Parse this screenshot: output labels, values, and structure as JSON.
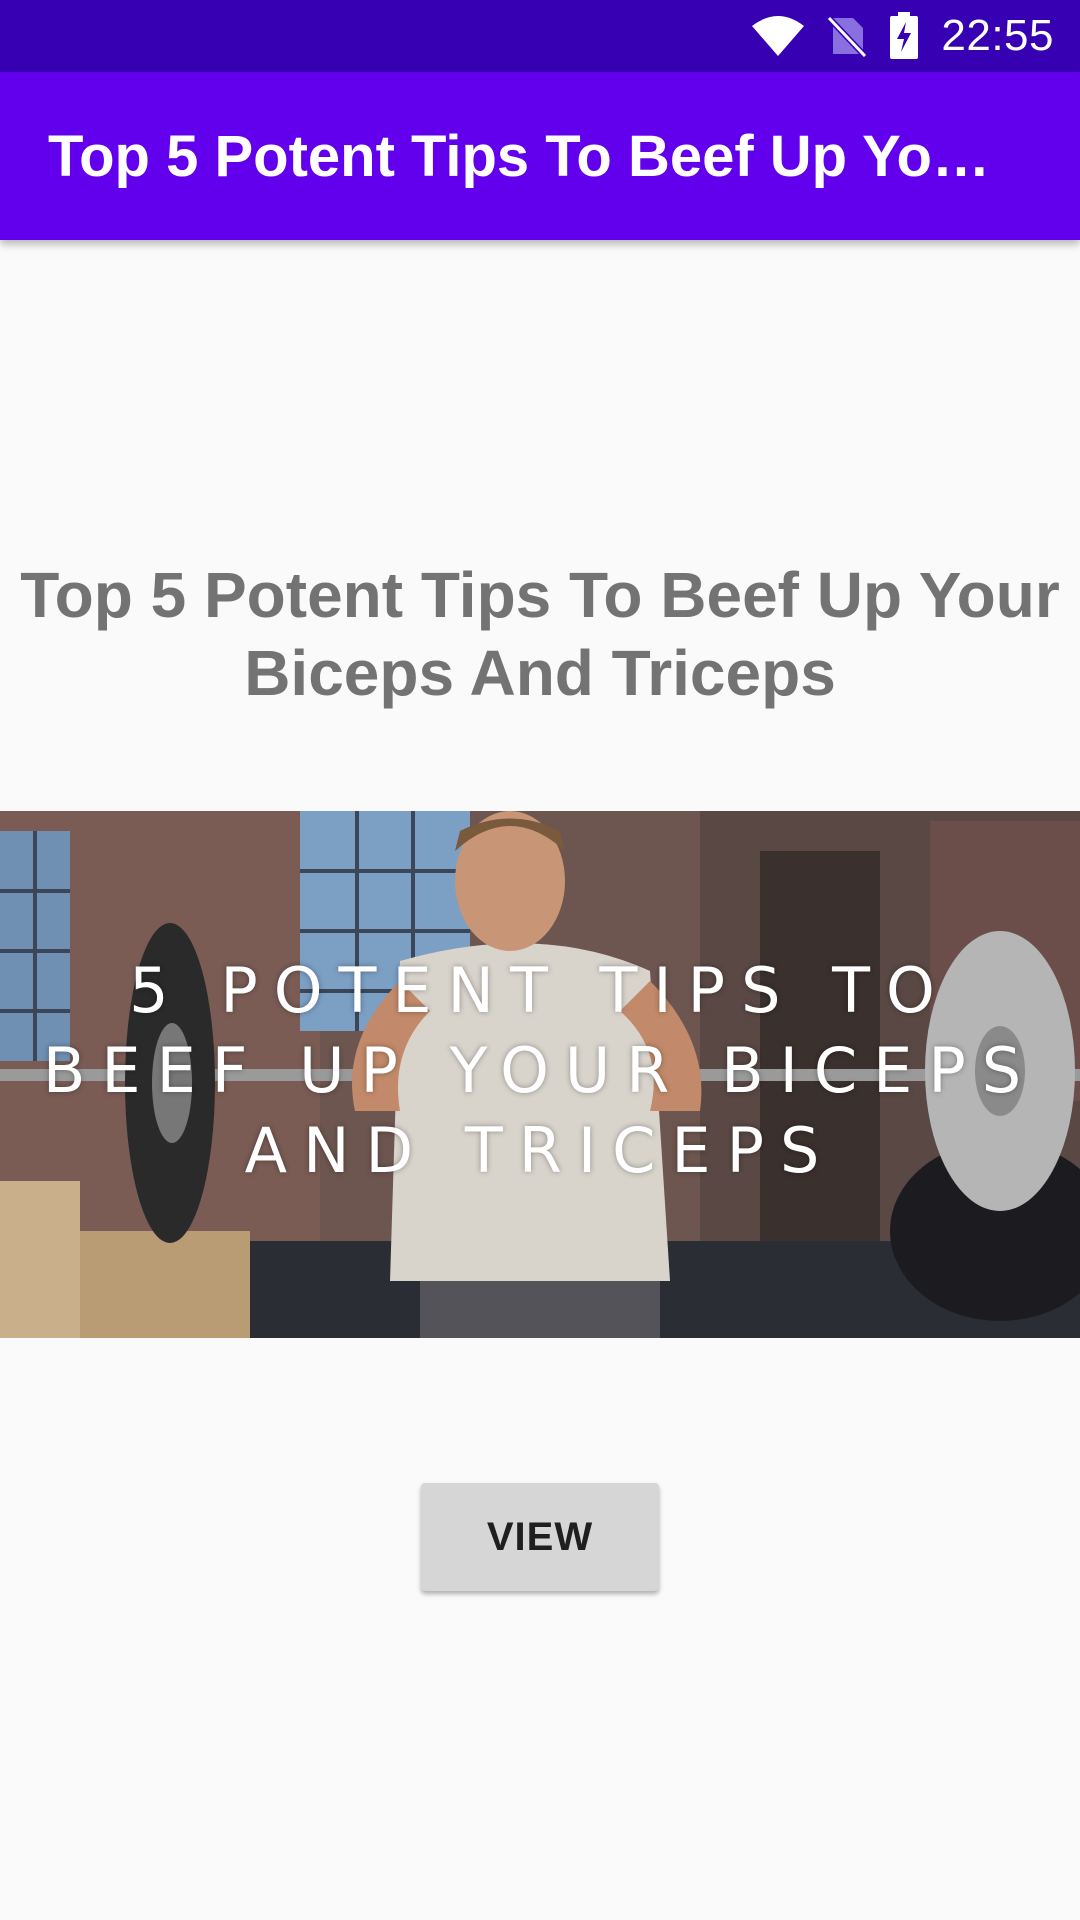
{
  "status_bar": {
    "time": "22:55",
    "icons": [
      "wifi-icon",
      "no-sim-icon",
      "battery-charging-icon"
    ],
    "background_color": "#3700b3"
  },
  "app_bar": {
    "title": "Top 5 Potent Tips To Beef Up Your…",
    "background_color": "#6200ee"
  },
  "content": {
    "title": "Top 5 Potent Tips To Beef Up Your Biceps And Triceps",
    "hero_image": {
      "overlay_text": "5 POTENT TIPS TO BEEF UP YOUR BICEPS AND TRICEPS"
    },
    "view_button_label": "VIEW"
  }
}
